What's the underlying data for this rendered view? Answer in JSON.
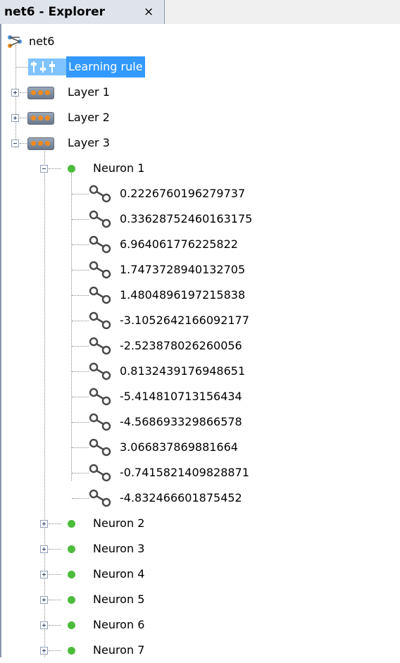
{
  "tab": {
    "title": "net6 - Explorer",
    "close": "×"
  },
  "tree": {
    "root": "net6",
    "learning_rule": "Learning rule",
    "layers": [
      "Layer 1",
      "Layer 2",
      "Layer 3"
    ],
    "expanded_neuron": "Neuron 1",
    "weights": [
      "0.2226760196279737",
      "0.33628752460163175",
      "6.96406177622582 2",
      "1.7473728940132705",
      "1.4804896197215838",
      "-3.1052642166092177",
      "-2.523878026260056",
      "0.8132439176948651",
      "-5.414810713156434",
      "-4.568693329866578",
      "3.066837869881664",
      "-0.7415821409828871",
      "-4.832466601875452"
    ],
    "collapsed_neurons": [
      "Neuron 2",
      "Neuron 3",
      "Neuron 4",
      "Neuron 5",
      "Neuron 6",
      "Neuron 7"
    ]
  },
  "colors": {
    "selection": "#3399ff",
    "neuron": "#4cbc3c",
    "layer_dot": "#f08a1c"
  },
  "icons": {
    "root": "network-icon",
    "learning_rule": "learning-rule-icon",
    "layer": "layer-icon",
    "neuron": "neuron-dot-icon",
    "weight": "connection-link-icon"
  }
}
